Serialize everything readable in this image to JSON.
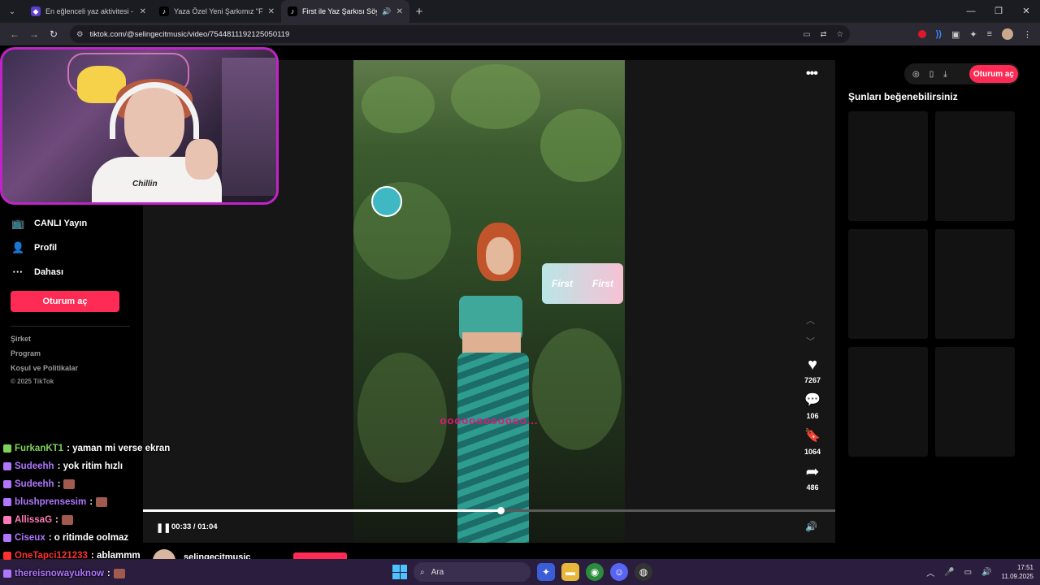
{
  "browser": {
    "tabs": [
      {
        "title": "En eğlenceli yaz aktivitesi - Qu",
        "active": false
      },
      {
        "title": "Yaza Özel Yeni Şarkımız \"First\" |",
        "active": false
      },
      {
        "title": "First ile Yaz Şarkısı Söyleme",
        "active": true
      }
    ],
    "new_tab_icon": "+",
    "url": "tiktok.com/@selingecitmusic/video/7544811192125050119"
  },
  "sidebar": {
    "items": [
      {
        "label": "CANLI Yayın",
        "icon": "live-icon"
      },
      {
        "label": "Profil",
        "icon": "profile-icon"
      },
      {
        "label": "Dahası",
        "icon": "more-icon"
      }
    ],
    "login_label": "Oturum aç",
    "footer": [
      "Şirket",
      "Program",
      "Koşul ve Politikalar"
    ],
    "copyright": "© 2025 TikTok"
  },
  "player": {
    "caption": "oooooooooooo...",
    "product_label_1": "First",
    "product_label_2": "First",
    "likes": "7267",
    "comments": "106",
    "saves": "1064",
    "shares": "486",
    "time": "00:33 / 01:04",
    "progress": 0.516,
    "author": "selingecitmusic"
  },
  "topright": {
    "login_label": "Oturum aç"
  },
  "recommendations": {
    "title": "Şunları beğenebilirsiniz",
    "count": 6
  },
  "webcam": {
    "shirt_text": "Chillin"
  },
  "chat": {
    "messages": [
      {
        "user": "FurkanKT1",
        "text": ": yaman mi verse ekran",
        "color": "#7dd35a"
      },
      {
        "user": "Sudeehh",
        "text": ": yok ritim hızlı",
        "color": "#b176ff"
      },
      {
        "user": "Sudeehh",
        "text": ":",
        "color": "#b176ff",
        "emote": true
      },
      {
        "user": "blushprensesim",
        "text": ":",
        "color": "#b176ff",
        "emote": true
      },
      {
        "user": "AllissaG",
        "text": ":",
        "color": "#ff7ab6",
        "emote": true
      },
      {
        "user": "Ciseux",
        "text": ": o ritimde oolmaz",
        "color": "#b176ff"
      },
      {
        "user": "OneTapci121233",
        "text": ": ablammm",
        "color": "#ff3030"
      },
      {
        "user": "thereisnowayuknow",
        "text": ":",
        "color": "#b176ff",
        "emote": true
      }
    ]
  },
  "taskbar": {
    "search_placeholder": "Ara",
    "time": "17:51",
    "date": "11.09.2025"
  },
  "colors": {
    "tiktok_red": "#fe2c55",
    "webcam_border": "#c223c8"
  }
}
